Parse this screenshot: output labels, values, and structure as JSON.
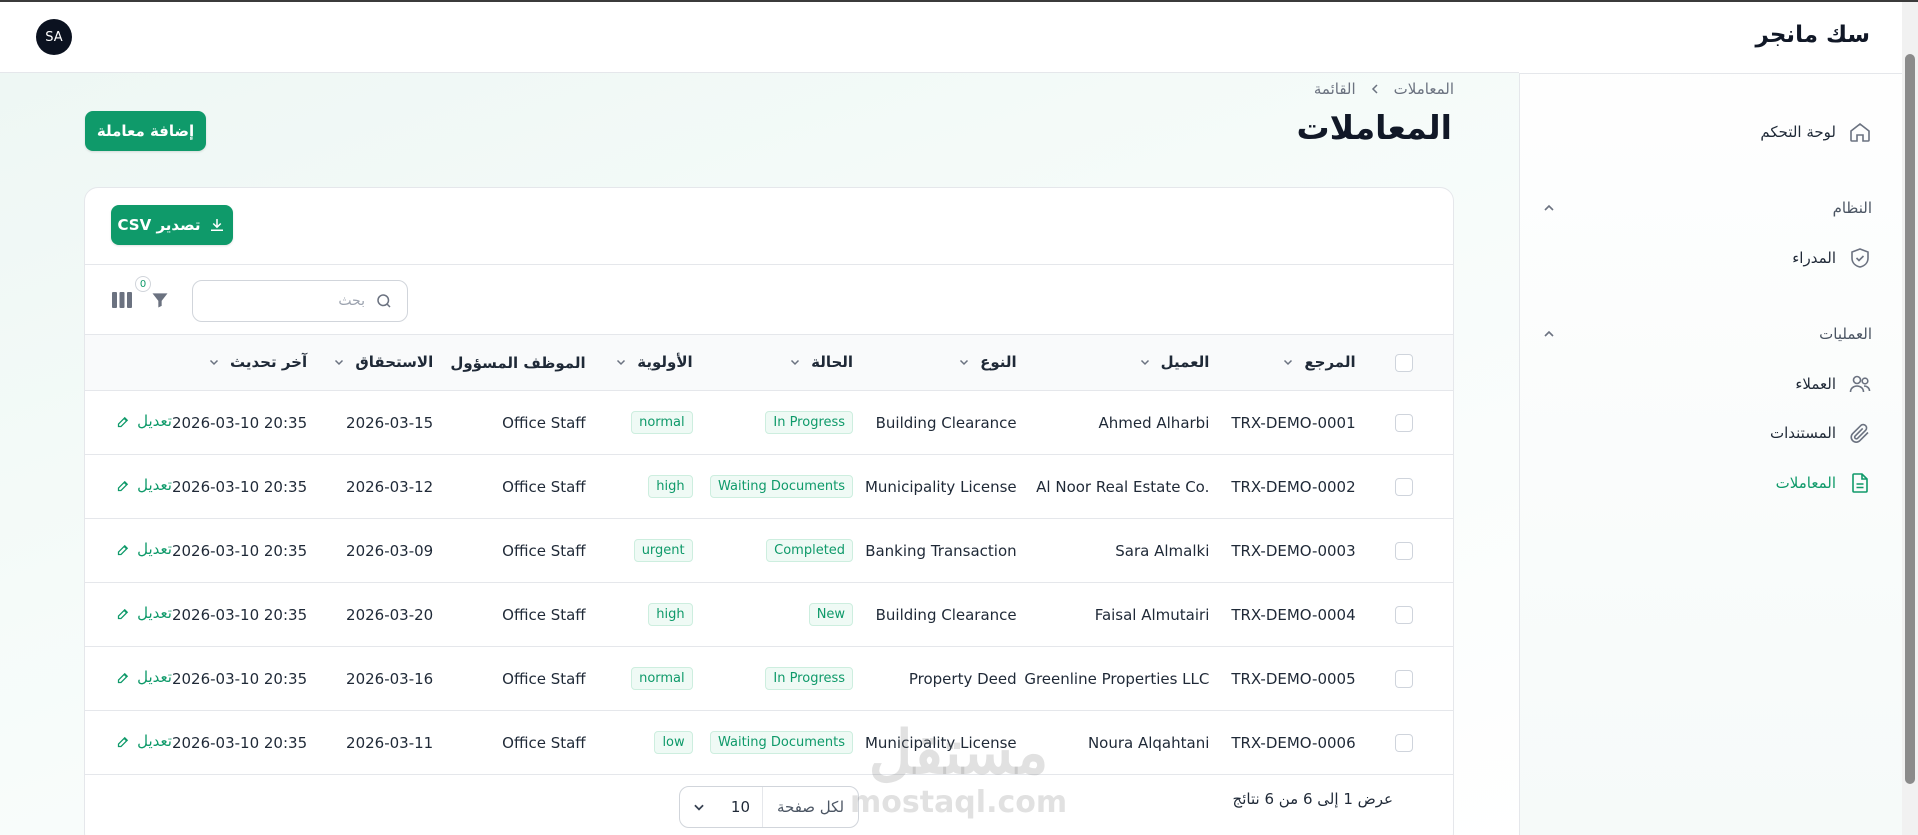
{
  "brand": {
    "title": "سك مانجر"
  },
  "header": {
    "avatar_initials": "SA"
  },
  "sidebar": {
    "dashboard": "لوحة التحكم",
    "section_system": "النظام",
    "managers": "المدراء",
    "section_operations": "العمليات",
    "clients": "العملاء",
    "documents": "المستندات",
    "transactions": "المعاملات"
  },
  "breadcrumb": {
    "root": "المعاملات",
    "current": "القائمة"
  },
  "page": {
    "title": "المعاملات",
    "add_button": "إضافة معاملة",
    "export_button": "تصدير CSV"
  },
  "toolbar": {
    "search_placeholder": "بحث",
    "filter_count": "0"
  },
  "table": {
    "columns": {
      "reference": "المرجع",
      "client": "العميل",
      "type": "النوع",
      "status": "الحالة",
      "priority": "الأولوية",
      "staff": "الموظف المسؤول",
      "due": "الاستحقاق",
      "updated": "آخر تحديث"
    },
    "edit_label": "تعديل",
    "rows": [
      {
        "ref": "TRX-DEMO-0001",
        "client": "Ahmed Alharbi",
        "type": "Building Clearance",
        "status": "In Progress",
        "priority": "normal",
        "staff": "Office Staff",
        "due": "2026-03-15",
        "updated": "2026-03-10 20:35"
      },
      {
        "ref": "TRX-DEMO-0002",
        "client": "Al Noor Real Estate Co.",
        "type": "Municipality License",
        "status": "Waiting Documents",
        "priority": "high",
        "staff": "Office Staff",
        "due": "2026-03-12",
        "updated": "2026-03-10 20:35"
      },
      {
        "ref": "TRX-DEMO-0003",
        "client": "Sara Almalki",
        "type": "Banking Transaction",
        "status": "Completed",
        "priority": "urgent",
        "staff": "Office Staff",
        "due": "2026-03-09",
        "updated": "2026-03-10 20:35"
      },
      {
        "ref": "TRX-DEMO-0004",
        "client": "Faisal Almutairi",
        "type": "Building Clearance",
        "status": "New",
        "priority": "high",
        "staff": "Office Staff",
        "due": "2026-03-20",
        "updated": "2026-03-10 20:35"
      },
      {
        "ref": "TRX-DEMO-0005",
        "client": "Greenline Properties LLC",
        "type": "Property Deed",
        "status": "In Progress",
        "priority": "normal",
        "staff": "Office Staff",
        "due": "2026-03-16",
        "updated": "2026-03-10 20:35"
      },
      {
        "ref": "TRX-DEMO-0006",
        "client": "Noura Alqahtani",
        "type": "Municipality License",
        "status": "Waiting Documents",
        "priority": "low",
        "staff": "Office Staff",
        "due": "2026-03-11",
        "updated": "2026-03-10 20:35"
      }
    ]
  },
  "footer": {
    "summary": "عرض 1 إلى 6 من 6 نتائج",
    "per_page_label": "لكل صفحة",
    "per_page_value": "10"
  },
  "watermark": {
    "arabic": "مستقل",
    "latin": "mostaql.com"
  },
  "colors": {
    "accent": "#0f9a6a",
    "badge_bg": "#effaf5",
    "text": "#1f2937"
  }
}
